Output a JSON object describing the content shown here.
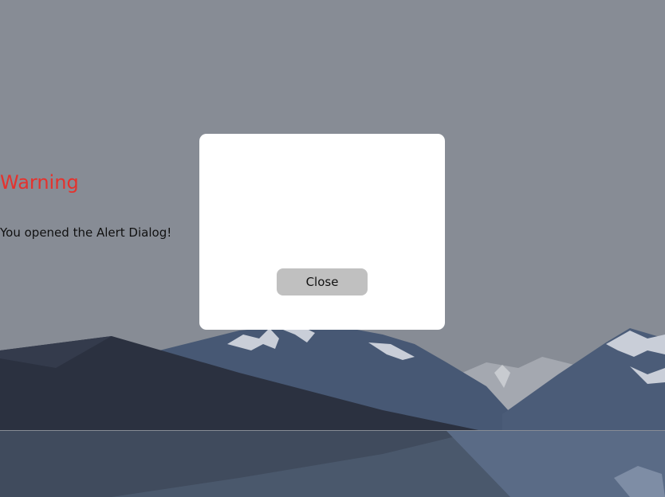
{
  "dialog": {
    "title": "Warning",
    "message": "You opened the Alert Dialog!",
    "close_label": "Close"
  },
  "colors": {
    "overlay": "#8a8f98",
    "dialog_bg": "#ffffff",
    "title": "#e5322d",
    "button_bg": "#c0c0c0"
  }
}
